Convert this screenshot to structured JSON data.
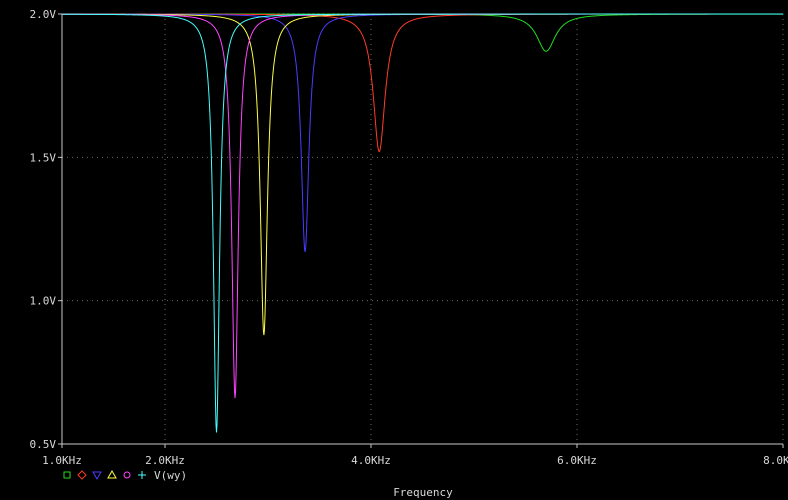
{
  "chart_data": {
    "type": "line",
    "title": "",
    "xlabel": "Frequency",
    "ylabel": "",
    "xlim": [
      1000,
      8000
    ],
    "ylim": [
      0.5,
      2.0
    ],
    "x_ticks": [
      {
        "value": 1000,
        "label": "1.0KHz"
      },
      {
        "value": 2000,
        "label": "2.0KHz"
      },
      {
        "value": 4000,
        "label": "4.0KHz"
      },
      {
        "value": 6000,
        "label": "6.0KHz"
      },
      {
        "value": 8000,
        "label": "8.0KHz"
      }
    ],
    "y_ticks": [
      {
        "value": 0.5,
        "label": "0.5V"
      },
      {
        "value": 1.0,
        "label": "1.0V"
      },
      {
        "value": 1.5,
        "label": "1.5V"
      },
      {
        "value": 2.0,
        "label": "2.0V"
      }
    ],
    "grid": true,
    "legend_position": "bottom-left",
    "legend_label": "V(wy)",
    "series": [
      {
        "marker": "square",
        "color": "#22dd22",
        "notch_freq": 5700,
        "notch_min": 1.87,
        "notch_width": 110
      },
      {
        "marker": "diamond",
        "color": "#ff3c2a",
        "notch_freq": 4080,
        "notch_min": 1.52,
        "notch_width": 70
      },
      {
        "marker": "triangle-down",
        "color": "#4a3cff",
        "notch_freq": 3360,
        "notch_min": 1.17,
        "notch_width": 45
      },
      {
        "marker": "triangle-up",
        "color": "#ffff44",
        "notch_freq": 2960,
        "notch_min": 0.88,
        "notch_width": 42
      },
      {
        "marker": "circle",
        "color": "#ff44ff",
        "notch_freq": 2680,
        "notch_min": 0.66,
        "notch_width": 38
      },
      {
        "marker": "plus",
        "color": "#44ffff",
        "notch_freq": 2500,
        "notch_min": 0.54,
        "notch_width": 36
      }
    ]
  }
}
